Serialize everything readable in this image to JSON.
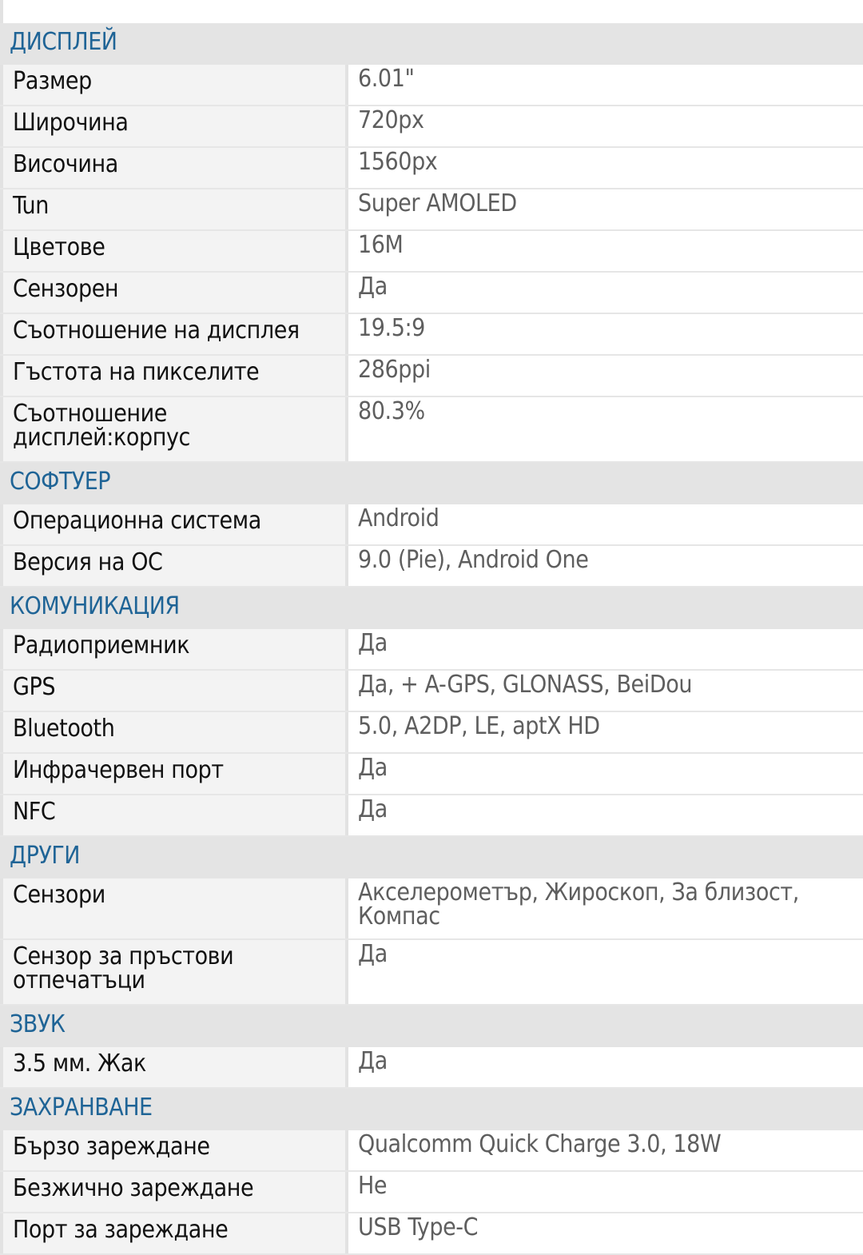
{
  "sections": [
    {
      "title": "ДИСПЛЕЙ",
      "rows": [
        {
          "label": "Размер",
          "value": "6.01\""
        },
        {
          "label": "Широчина",
          "value": "720px"
        },
        {
          "label": "Височина",
          "value": "1560px"
        },
        {
          "label": "Tun",
          "value": "Super AMOLED"
        },
        {
          "label": "Цветове",
          "value": "16M"
        },
        {
          "label": "Сензорен",
          "value": "Да"
        },
        {
          "label": "Съотношение на дисплея",
          "value": "19.5:9"
        },
        {
          "label": "Гъстота на пикселите",
          "value": "286ppi"
        },
        {
          "label": "Съотношение дисплей:корпус",
          "value": "80.3%"
        }
      ]
    },
    {
      "title": "СОФТУЕР",
      "rows": [
        {
          "label": "Операционна система",
          "value": "Android"
        },
        {
          "label": "Версия на ОС",
          "value": "9.0 (Pie), Android One"
        }
      ]
    },
    {
      "title": "КОМУНИКАЦИЯ",
      "rows": [
        {
          "label": "Радиоприемник",
          "value": "Да"
        },
        {
          "label": "GPS",
          "value": "Да, + A-GPS, GLONASS, BeiDou"
        },
        {
          "label": "Bluetooth",
          "value": "5.0, A2DP, LE, aptX HD"
        },
        {
          "label": "Инфрачервен порт",
          "value": "Да"
        },
        {
          "label": "NFC",
          "value": "Да"
        }
      ]
    },
    {
      "title": "ДРУГИ",
      "rows": [
        {
          "label": "Сензори",
          "value": "Акселерометър, Жироскоп, За близост, Компас"
        },
        {
          "label": "Сензор за пръстови отпечатъци",
          "value": "Да"
        }
      ]
    },
    {
      "title": "ЗВУК",
      "rows": [
        {
          "label": "3.5 мм. Жак",
          "value": "Да"
        }
      ]
    },
    {
      "title": "ЗАХРАНВАНЕ",
      "rows": [
        {
          "label": "Бързо зареждане",
          "value": "Qualcomm Quick Charge 3.0, 18W"
        },
        {
          "label": "Безжично зареждане",
          "value": "Не"
        },
        {
          "label": "Порт за зареждане",
          "value": "USB Type-C"
        }
      ]
    }
  ]
}
